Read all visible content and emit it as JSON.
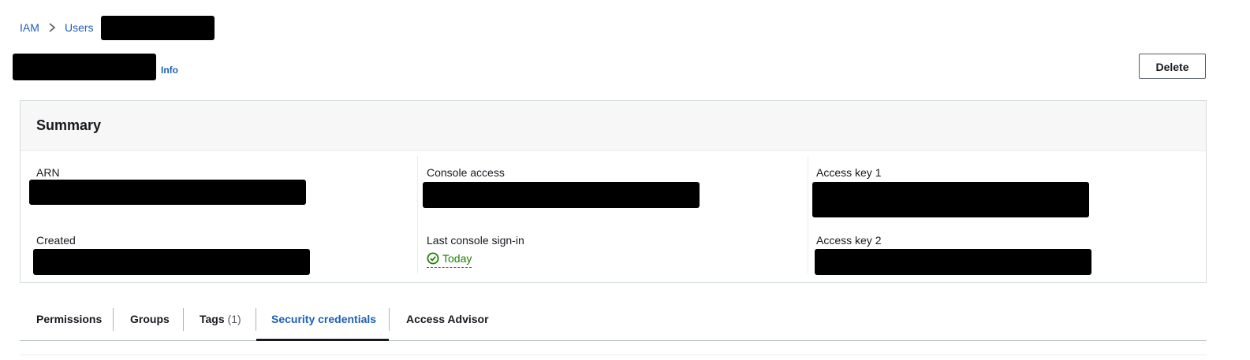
{
  "breadcrumb": {
    "items": [
      "IAM",
      "Users"
    ],
    "separator_icon": "chevron-right-icon"
  },
  "header": {
    "info_label": "Info",
    "delete_label": "Delete"
  },
  "summary": {
    "title": "Summary",
    "fields": {
      "arn_label": "ARN",
      "created_label": "Created",
      "console_access_label": "Console access",
      "last_signin_label": "Last console sign-in",
      "last_signin_value": "Today",
      "access_key1_label": "Access key 1",
      "access_key2_label": "Access key 2"
    },
    "status_icon": "check-circle-icon"
  },
  "tabs": {
    "items": [
      "Permissions",
      "Groups",
      "Tags",
      "Security credentials",
      "Access Advisor"
    ],
    "tags_count": "(1)",
    "active": "Security credentials"
  },
  "colors": {
    "link": "#1d5fb8",
    "success": "#1d8102",
    "text": "#16191f",
    "border": "#d5dbdb"
  }
}
